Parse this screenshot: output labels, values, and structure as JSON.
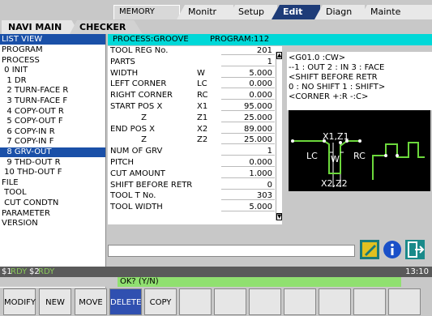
{
  "topbar": {
    "memory_label": "MEMORY",
    "tabs": [
      "Monitr",
      "Setup",
      "Edit",
      "Diagn",
      "Mainte"
    ],
    "active_tab": "Edit"
  },
  "nav": {
    "main_label": "NAVI MAIN",
    "checker_label": "CHECKER"
  },
  "list": {
    "header": "LIST VIEW",
    "items": [
      "PROGRAM",
      "PROCESS",
      " 0 INIT",
      "  1 DR",
      "  2 TURN-FACE R",
      "  3 TURN-FACE F",
      "  4 COPY-OUT R",
      "  5 COPY-OUT F",
      "  6 COPY-IN R",
      "  7 COPY-IN F",
      "  8 GRV-OUT",
      "  9 THD-OUT R",
      " 10 THD-OUT F",
      "FILE",
      " TOOL",
      " CUT CONDTN",
      "PARAMETER",
      "VERSION"
    ],
    "selected_index": 10
  },
  "process_header": {
    "process": "PROCESS:GROOVE",
    "program": "PROGRAM:112"
  },
  "params": [
    {
      "label": "TOOL REG No.",
      "sym": "",
      "value": "201"
    },
    {
      "label": "PARTS",
      "sym": "",
      "value": "1"
    },
    {
      "label": "WIDTH",
      "sym": "W",
      "value": "5.000"
    },
    {
      "label": "LEFT CORNER",
      "sym": "LC",
      "value": "0.000"
    },
    {
      "label": "RIGHT CORNER",
      "sym": "RC",
      "value": "0.000"
    },
    {
      "label": "START POS X",
      "sym": "X1",
      "value": "95.000"
    },
    {
      "label": "            Z",
      "sym": "Z1",
      "value": "25.000"
    },
    {
      "label": "END POS X",
      "sym": "X2",
      "value": "89.000"
    },
    {
      "label": "            Z",
      "sym": "Z2",
      "value": "25.000"
    },
    {
      "label": "NUM OF GRV",
      "sym": "",
      "value": "1"
    },
    {
      "label": "PITCH",
      "sym": "",
      "value": "0.000"
    },
    {
      "label": "CUT AMOUNT",
      "sym": "",
      "value": "1.000"
    },
    {
      "label": "SHIFT BEFORE RETR",
      "sym": "",
      "value": "0"
    },
    {
      "label": "TOOL T No.",
      "sym": "",
      "value": "303"
    },
    {
      "label": "TOOL WIDTH",
      "sym": "",
      "value": "5.000"
    }
  ],
  "info": {
    "line1": "<G01.0 :CW>",
    "line2": "--1 : OUT   2 : IN 3 : FACE",
    "line3": "<SHIFT BEFORE RETR",
    "line4": "0 : NO SHIFT   1 : SHIFT>",
    "line5": "<CORNER +:R  -:C>"
  },
  "diagram": {
    "label_x1z1": "X1,Z1",
    "label_lc": "LC",
    "label_w": "W",
    "label_rc": "RC",
    "label_x2z2": "X2,Z2"
  },
  "status": {
    "sys1": "$1",
    "rdy1": "RDY",
    "sys2": "$2",
    "rdy2": "RDY",
    "time": "13:10"
  },
  "message": "OK? (Y/N)",
  "softkeys": [
    "MODIFY",
    "NEW",
    "MOVE",
    "DELETE",
    "COPY",
    "",
    "",
    "",
    "",
    "",
    "",
    ""
  ],
  "softkey_active": "DELETE"
}
